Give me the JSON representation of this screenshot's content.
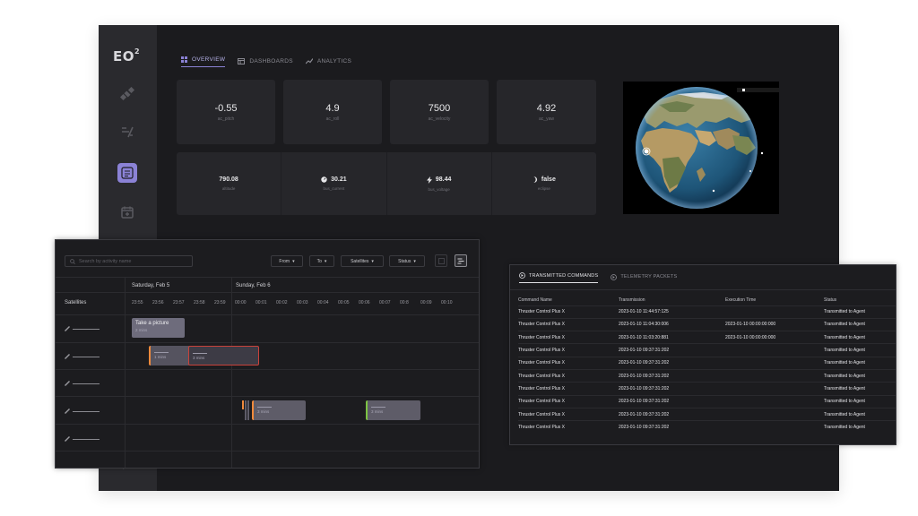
{
  "brand": {
    "logo_text": "EO",
    "logo_sup": "2"
  },
  "tabs": [
    {
      "label": "OVERVIEW",
      "icon": "grid-icon",
      "active": true
    },
    {
      "label": "DASHBOARDS",
      "icon": "dashboard-icon",
      "active": false
    },
    {
      "label": "ANALYTICS",
      "icon": "chart-icon",
      "active": false
    }
  ],
  "stats_top": [
    {
      "value": "-0.55",
      "key": "ac_pitch"
    },
    {
      "value": "4.9",
      "key": "ac_roll"
    },
    {
      "value": "7500",
      "key": "ac_velocity"
    },
    {
      "value": "4.92",
      "key": "ac_yaw"
    }
  ],
  "stats_bottom": [
    {
      "value": "790.08",
      "key": "altitude",
      "icon": ""
    },
    {
      "value": "30.21",
      "key": "bus_current",
      "icon": "gauge-icon"
    },
    {
      "value": "98.44",
      "key": "bus_voltage",
      "icon": "bolt-icon"
    },
    {
      "value": "false",
      "key": "eclipse",
      "icon": "moon-icon"
    }
  ],
  "timeline": {
    "search_placeholder": "Search by activity name",
    "filters": [
      "From",
      "To",
      "Satellites",
      "Status"
    ],
    "satellites_header": "Satellites",
    "day1": "Saturday, Feb 5",
    "day2": "Sunday, Feb 6",
    "ticks": [
      "23:55",
      "23:56",
      "23:57",
      "23:58",
      "23:59",
      "00:00",
      "00:01",
      "00:02",
      "00:03",
      "00:04",
      "00:05",
      "00:06",
      "00:07",
      "00:8",
      "00:09",
      "00:10"
    ],
    "activities": [
      {
        "title": "Take a picture",
        "duration": "2 mins"
      },
      {
        "duration": "1 mins"
      },
      {
        "duration": "3 mins"
      },
      {
        "duration": "3 mins"
      },
      {
        "duration": "3 mins"
      }
    ]
  },
  "commands": {
    "tab_transmitted": "TRANSMITTED COMMANDS",
    "tab_telemetry": "TELEMETRY PACKETS",
    "columns": [
      "Command Name",
      "Transmission",
      "Execution Time",
      "Status"
    ],
    "rows": [
      [
        "Thruster Control Plus X",
        "2023-01-10 11:44:57:125",
        "",
        "Transmitted to Agent"
      ],
      [
        "Thruster Control Plus X",
        "2023-01-10 11:04:30:006",
        "2023-01-10 00:00:00:000",
        "Transmitted to Agent"
      ],
      [
        "Thruster Control Plus X",
        "2023-01-10 11:03:20:881",
        "2023-01-10 00:00:00:000",
        "Transmitted to Agent"
      ],
      [
        "Thruster Control Plus X",
        "2023-01-10 09:37:31:202",
        "",
        "Transmitted to Agent"
      ],
      [
        "Thruster Control Plus X",
        "2023-01-10 09:37:31:202",
        "",
        "Transmitted to Agent"
      ],
      [
        "Thruster Control Plus X",
        "2023-01-10 09:37:31:202",
        "",
        "Transmitted to Agent"
      ],
      [
        "Thruster Control Plus X",
        "2023-01-10 09:37:31:202",
        "",
        "Transmitted to Agent"
      ],
      [
        "Thruster Control Plus X",
        "2023-01-10 09:37:31:202",
        "",
        "Transmitted to Agent"
      ],
      [
        "Thruster Control Plus X",
        "2023-01-10 09:37:31:202",
        "",
        "Transmitted to Agent"
      ],
      [
        "Thruster Control Plus X",
        "2023-01-10 09:37:31:202",
        "",
        "Transmitted to Agent"
      ]
    ]
  },
  "colors": {
    "accent": "#8b82d6",
    "orange": "#f08a3c",
    "green": "#7cc243",
    "red": "#c8423a"
  }
}
